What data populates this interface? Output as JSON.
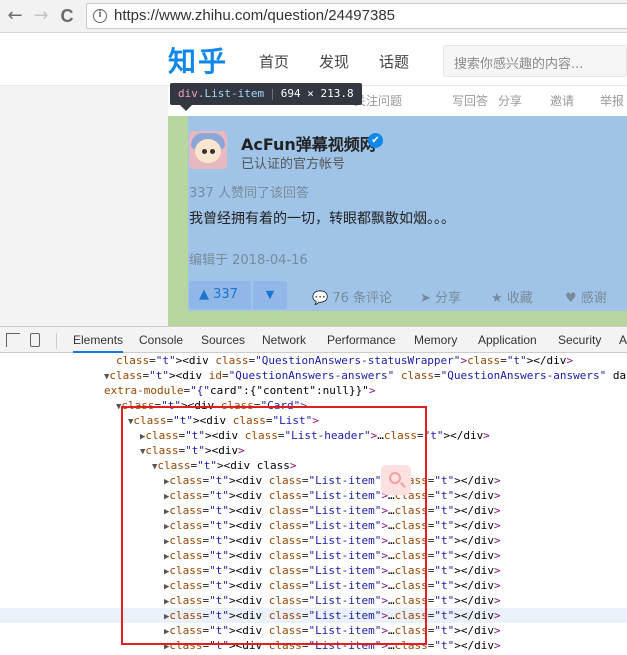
{
  "browser": {
    "url": "https://www.zhihu.com/question/24497385",
    "back_glyph": "←",
    "forward_glyph": "→",
    "reload_glyph": "C",
    "info_glyph": "i"
  },
  "zhihu": {
    "logo": "知乎",
    "nav": [
      "首页",
      "发现",
      "话题"
    ],
    "search_placeholder": "搜索你感兴趣的内容...",
    "subbar": [
      "关注问题",
      "写回答",
      "分享",
      "邀请",
      "举报"
    ]
  },
  "inspector_tooltip": {
    "tag": "div",
    "cls": ".List-item",
    "size": "694 × 213.8"
  },
  "answer": {
    "author_name": "AcFun弹幕视频网",
    "verified_glyph": "✔",
    "author_desc": "已认证的官方帐号",
    "voters": "337 人赞同了该回答",
    "content": "我曾经拥有着的一切，转眼都飘散如烟。。。",
    "edited": "编辑于 2018-04-16",
    "vote_up": "▲ 337",
    "vote_down": "▼",
    "actions": {
      "comments": "💬 76 条评论",
      "share": "➤ 分享",
      "collect": "★ 收藏",
      "thanks": "♥ 感谢"
    }
  },
  "devtools": {
    "tabs": [
      "Elements",
      "Console",
      "Sources",
      "Network",
      "Performance",
      "Memory",
      "Application",
      "Security",
      "A"
    ],
    "active_tab": "Elements",
    "lines": [
      {
        "text": "<div class=\"QuestionAnswers-statusWrapper\"></div>"
      },
      {
        "text": "▼<div id=\"QuestionAnswers-answers\" class=\"QuestionAnswers-answers\" data-zop-feed"
      },
      {
        "text": "extra-module=\"{\"card\":{\"content\":null}}\">"
      },
      {
        "text": "▼<div class=\"Card\">"
      },
      {
        "text": "▼<div class=\"List\">"
      },
      {
        "text": "▶<div class=\"List-header\">…</div>"
      },
      {
        "text": "▼<div>"
      },
      {
        "text": "▼<div class>"
      },
      {
        "text": "▶<div class=\"List-item\">…</div>"
      },
      {
        "text": "▶<div class=\"List-item\">…</div>"
      },
      {
        "text": "▶<div class=\"List-item\">…</div>"
      },
      {
        "text": "▶<div class=\"List-item\">…</div>"
      },
      {
        "text": "▶<div class=\"List-item\">…</div>"
      },
      {
        "text": "▶<div class=\"List-item\">…</div>"
      },
      {
        "text": "▶<div class=\"List-item\">…</div>"
      },
      {
        "text": "▶<div class=\"List-item\">…</div>"
      },
      {
        "text": "▶<div class=\"List-item\">…</div>"
      },
      {
        "text": "▶<div class=\"List-item\">…</div>"
      },
      {
        "text": "▶<div class=\"List-item\">…</div>"
      },
      {
        "text": "▶<div class=\"List-item\">…</div>"
      }
    ]
  },
  "colors": {
    "zhihu_blue": "#0f88eb",
    "highlight_content": "#a0c4e8",
    "highlight_margin": "#b8d6a0",
    "annotation_red": "#e02020"
  }
}
